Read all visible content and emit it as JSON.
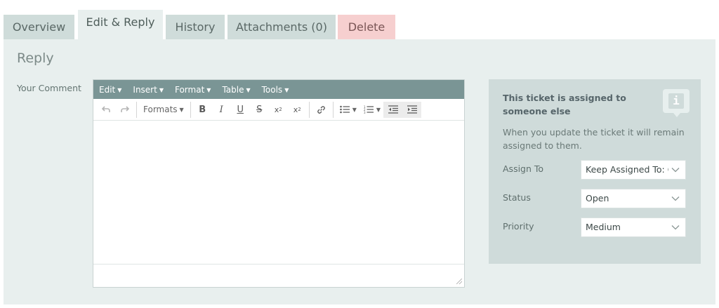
{
  "tabs": [
    {
      "label": "Overview",
      "active": false
    },
    {
      "label": "Edit & Reply",
      "active": true
    },
    {
      "label": "History",
      "active": false
    },
    {
      "label": "Attachments (0)",
      "active": false
    },
    {
      "label": "Delete",
      "active": false
    }
  ],
  "reply": {
    "title": "Reply",
    "comment_label": "Your Comment"
  },
  "editor": {
    "menu": [
      "Edit",
      "Insert",
      "Format",
      "Table",
      "Tools"
    ],
    "formats_label": "Formats",
    "toolbar_icons": [
      "undo-icon",
      "redo-icon",
      "bold-icon",
      "italic-icon",
      "underline-icon",
      "strikethrough-icon",
      "superscript-icon",
      "subscript-icon",
      "link-icon",
      "bullet-list-icon",
      "numbered-list-icon",
      "outdent-icon",
      "indent-icon"
    ],
    "content": ""
  },
  "info": {
    "title": "This ticket is assigned to someone else",
    "text": "When you update the ticket it will remain assigned to them.",
    "icon": "info-icon",
    "fields": [
      {
        "label": "Assign To",
        "value": "Keep Assigned To: Q\\"
      },
      {
        "label": "Status",
        "value": "Open"
      },
      {
        "label": "Priority",
        "value": "Medium"
      }
    ]
  },
  "colors": {
    "panel_bg": "#e8efee",
    "tab_bg": "#cfdcda",
    "delete_tab_bg": "#f6cfcf",
    "menubar_bg": "#7a9595",
    "infobox_bg": "#cfdbda"
  }
}
